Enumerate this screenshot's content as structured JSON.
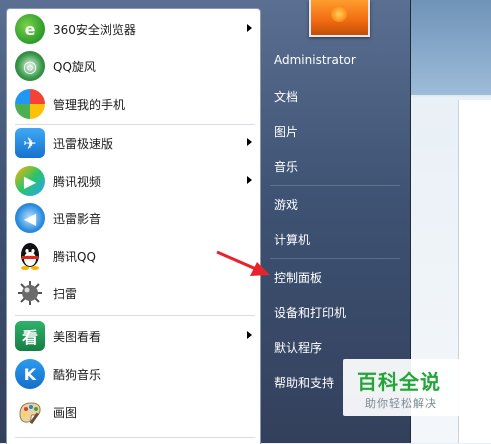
{
  "programs": [
    {
      "label": "360安全浏览器",
      "icon": "ie-360-browser-icon",
      "has_submenu": true
    },
    {
      "label": "QQ旋风",
      "icon": "qq-whirlwind-icon",
      "has_submenu": false
    },
    {
      "label": "管理我的手机",
      "icon": "phone-manager-icon",
      "has_submenu": false
    },
    {
      "label": "迅雷极速版",
      "icon": "xunlei-icon",
      "has_submenu": true
    },
    {
      "label": "腾讯视频",
      "icon": "tencent-video-icon",
      "has_submenu": true
    },
    {
      "label": "迅雷影音",
      "icon": "xunlei-player-icon",
      "has_submenu": false
    },
    {
      "label": "腾讯QQ",
      "icon": "qq-penguin-icon",
      "has_submenu": false
    },
    {
      "label": "扫雷",
      "icon": "minesweeper-icon",
      "has_submenu": false
    },
    {
      "label": "美图看看",
      "icon": "meitu-viewer-icon",
      "has_submenu": true
    },
    {
      "label": "酷狗音乐",
      "icon": "kugou-music-icon",
      "has_submenu": false
    },
    {
      "label": "画图",
      "icon": "paint-icon",
      "has_submenu": false
    }
  ],
  "right_menu": {
    "user": "Administrator",
    "items": [
      "文档",
      "图片",
      "音乐",
      "游戏",
      "计算机",
      "控制面板",
      "设备和打印机",
      "默认程序",
      "帮助和支持"
    ]
  },
  "watermark": {
    "title": "百科全说",
    "subtitle": "助你轻松解决"
  }
}
